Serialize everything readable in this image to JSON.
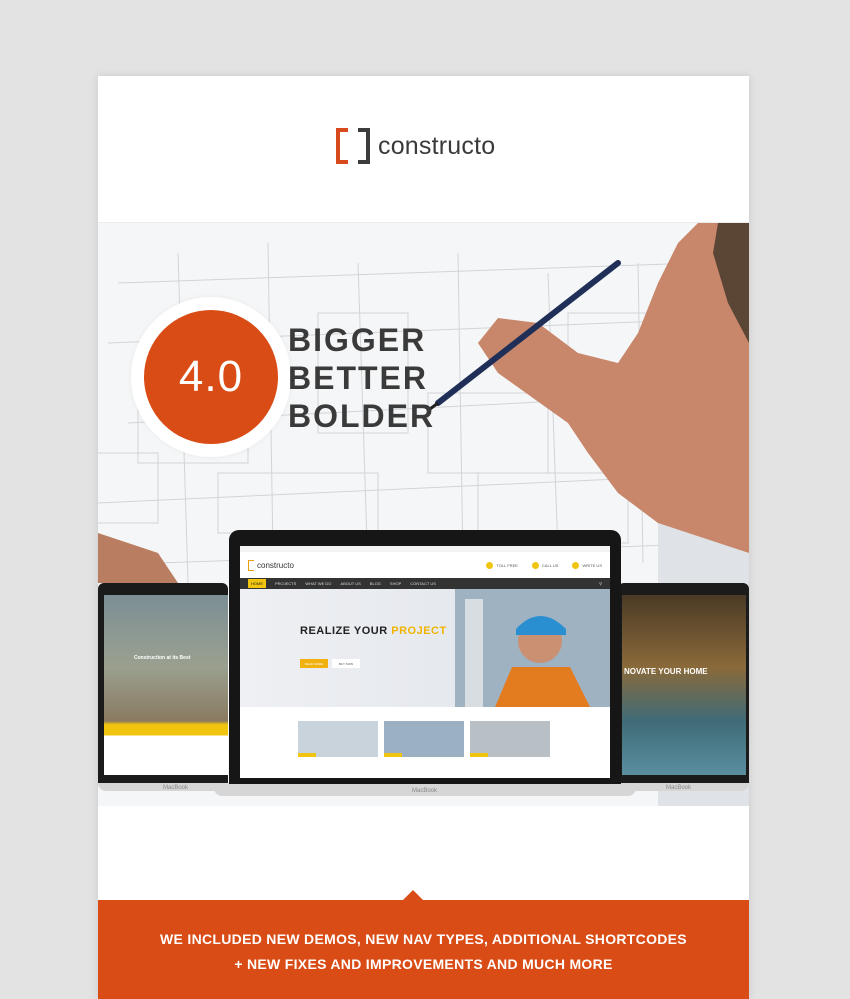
{
  "brand": {
    "name": "constructo",
    "accent": "#d94c16",
    "dark": "#3a3a3a"
  },
  "hero": {
    "badge": "4.0",
    "lines": [
      "BIGGER",
      "BETTER",
      "BOLDER"
    ]
  },
  "laptop": {
    "brand_label": "MacBook",
    "site": {
      "logo": "constructo",
      "info": [
        "TOLL FREE",
        "CALL US",
        "WRITE US"
      ],
      "nav": [
        "HOME",
        "PROJECTS",
        "WHAT WE DO",
        "ABOUT US",
        "BLOG",
        "SHOP",
        "CONTACT US"
      ],
      "hero_title": "REALIZE YOUR",
      "hero_highlight": "PROJECT",
      "btn_primary": "READ MORE",
      "btn_secondary": "BUY NOW"
    },
    "left_screen_title": "Construction at its Best",
    "right_screen_title": "NOVATE YOUR HOME"
  },
  "banner": {
    "line1": "WE INCLUDED NEW DEMOS, NEW NAV TYPES, ADDITIONAL SHORTCODES",
    "line2": "+ NEW FIXES AND IMPROVEMENTS AND MUCH MORE"
  }
}
